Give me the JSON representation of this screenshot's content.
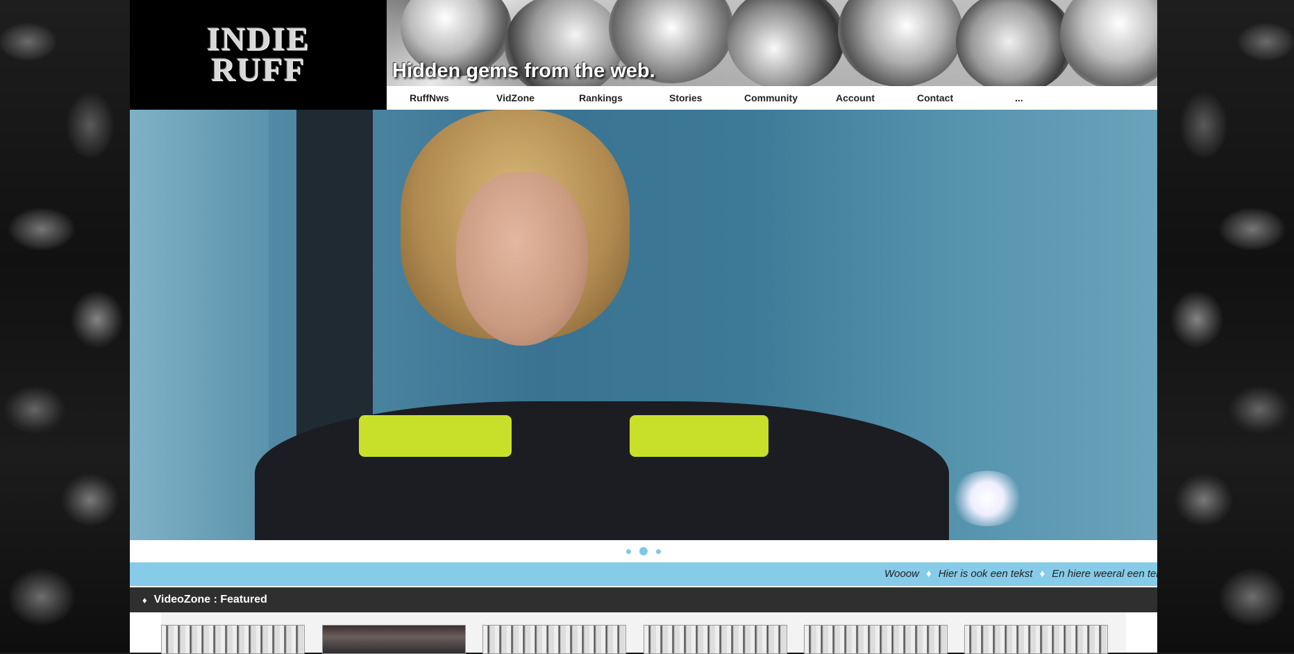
{
  "logo": {
    "line1": "INDIE",
    "line2": "RUFF"
  },
  "banner": {
    "tagline": "Hidden gems from the web."
  },
  "nav": {
    "items": [
      "RuffNws",
      "VidZone",
      "Rankings",
      "Stories",
      "Community",
      "Account",
      "Contact",
      "..."
    ]
  },
  "slider": {
    "dots": 3,
    "active_index": 1
  },
  "ticker": {
    "items": [
      "Wooow",
      "Hier is ook een tekst",
      "En hiere weeral een tekst"
    ],
    "separator": "♦"
  },
  "section": {
    "icon": "diamond-icon",
    "title": "VideoZone : Featured",
    "bullet": "♦"
  },
  "colors": {
    "ticker_bg": "#86cbe8",
    "section_bg": "#2f2f2f",
    "dot": "#7ec8e6"
  }
}
